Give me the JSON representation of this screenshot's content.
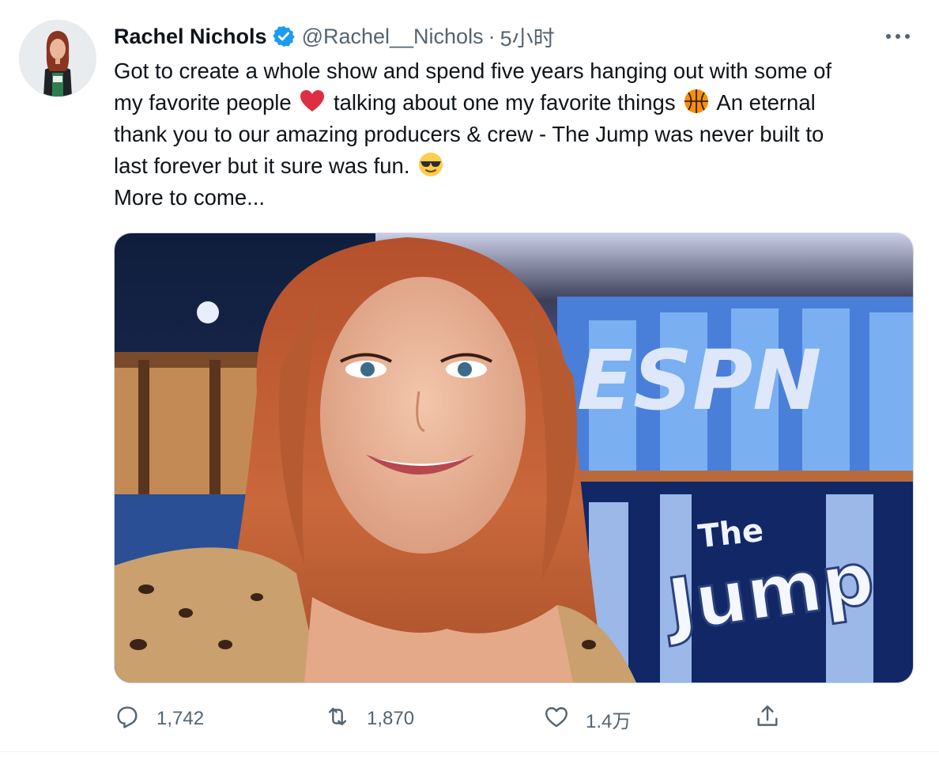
{
  "tweet": {
    "author_name": "Rachel Nichols",
    "handle": "@Rachel__Nichols",
    "separator": "·",
    "time": "5小时",
    "verified": true,
    "text_line_1_a": "Got to  create a whole show and spend five years hanging out with some of",
    "text_line_2_a": "my favorite people",
    "text_line_2_b": "talking about one my favorite things",
    "text_line_2_c": "An eternal",
    "text_line_3": "thank you  to our amazing producers & crew - The Jump was never built to",
    "text_line_4": "last forever but it sure was fun.",
    "text_line_5": "More to come...",
    "emojis": [
      "red-heart",
      "basketball",
      "smiling-face-with-sunglasses"
    ]
  },
  "media": {
    "logo_text": "ESPN",
    "show_title_small": "The",
    "show_title_large": "Jump"
  },
  "actions": {
    "reply_count": "1,742",
    "retweet_count": "1,870",
    "like_count": "1.4万",
    "share_label": ""
  },
  "colors": {
    "text": "#0f1419",
    "secondary": "#536471",
    "verified_blue": "#1d9bf0",
    "border": "#cfd9de"
  }
}
